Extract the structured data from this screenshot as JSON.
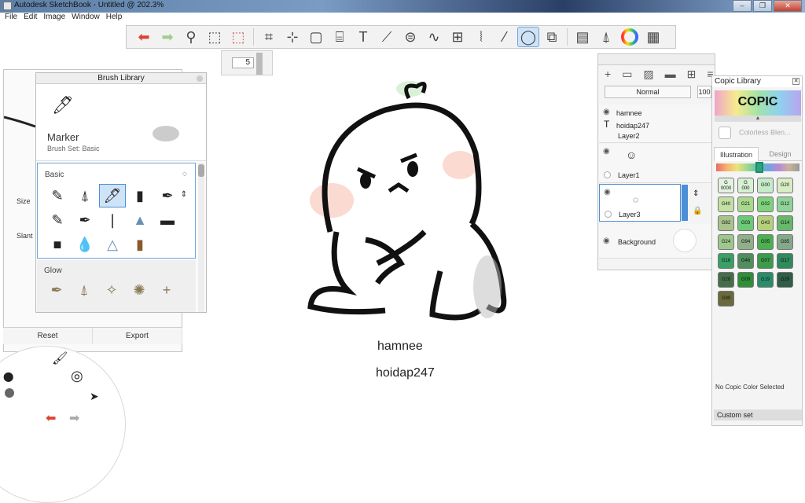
{
  "window": {
    "title": "Autodesk SketchBook - Untitled @ 202.3%",
    "min": "–",
    "max": "❐",
    "close": "✕"
  },
  "menu": [
    "File",
    "Edit",
    "Image",
    "Window",
    "Help"
  ],
  "toolbar": {
    "tools": [
      "undo-icon",
      "redo-icon",
      "zoom-icon",
      "select-icon",
      "crop-select-icon",
      "crop-icon",
      "lasso-icon",
      "transform-icon",
      "cylinder-icon",
      "text-icon",
      "ruler-icon",
      "ellipse-icon",
      "curve-icon",
      "perspective-icon",
      "symmetry-icon",
      "stroke-icon",
      "lasso-stroke-icon",
      "shapes-icon",
      "copic-icon",
      "brush-icon",
      "color-wheel-icon",
      "palette-icon"
    ],
    "active_tool": "lasso-stroke-icon"
  },
  "brush_size_value": "5",
  "brush_library": {
    "title": "Brush Library",
    "current_brush": "Marker",
    "brush_set": "Brush Set: Basic",
    "sections": [
      {
        "label": "Basic"
      },
      {
        "label": "Glow"
      }
    ],
    "buttons": {
      "reset": "Reset",
      "export": "Export"
    }
  },
  "back_panel": {
    "size_label": "Size",
    "slant_label": "Slant"
  },
  "layers": {
    "blend_mode": "Normal",
    "opacity": "100",
    "rows": [
      {
        "lines": [
          "hamnee",
          "hoidap247",
          "Layer2"
        ]
      },
      {
        "lines": [
          "Layer1"
        ]
      },
      {
        "lines": [
          "Layer3"
        ]
      },
      {
        "lines": [
          "Background"
        ]
      }
    ]
  },
  "copic": {
    "title": "Copic Library",
    "logo": "COPIC",
    "colorless": "Colorless Blen...",
    "tabs": [
      "Illustration",
      "Design"
    ],
    "swatches": [
      {
        "code": "G\n0000",
        "color": "#e3f3df"
      },
      {
        "code": "G\n000",
        "color": "#d8f0d3"
      },
      {
        "code": "G00",
        "color": "#c6ebc9"
      },
      {
        "code": "G20",
        "color": "#d8edc5"
      },
      {
        "code": "G40",
        "color": "#c2e0a3"
      },
      {
        "code": "G21",
        "color": "#a9d98d"
      },
      {
        "code": "G02",
        "color": "#7ed27d"
      },
      {
        "code": "G12",
        "color": "#8fd39b"
      },
      {
        "code": "G82",
        "color": "#a9c38c"
      },
      {
        "code": "G03",
        "color": "#6cc978"
      },
      {
        "code": "G43",
        "color": "#b7cf7d"
      },
      {
        "code": "G14",
        "color": "#66b86a"
      },
      {
        "code": "G24",
        "color": "#9ec78d"
      },
      {
        "code": "G94",
        "color": "#8fb089"
      },
      {
        "code": "G05",
        "color": "#4caf50"
      },
      {
        "code": "G85",
        "color": "#83a98a"
      },
      {
        "code": "G16",
        "color": "#3aa065"
      },
      {
        "code": "G46",
        "color": "#4f8f5d"
      },
      {
        "code": "G07",
        "color": "#3c9b4a"
      },
      {
        "code": "G17",
        "color": "#2f8a5c"
      },
      {
        "code": "G28",
        "color": "#456f4b"
      },
      {
        "code": "G09",
        "color": "#2f8f39"
      },
      {
        "code": "G19",
        "color": "#2a8d6a"
      },
      {
        "code": "G29",
        "color": "#2f5f48"
      },
      {
        "code": "G99",
        "color": "#6b6a3c"
      }
    ],
    "no_color": "No Copic Color Selected",
    "custom_set": "Custom set"
  },
  "canvas": {
    "line1": "hamnee",
    "line2": "hoidap247"
  }
}
